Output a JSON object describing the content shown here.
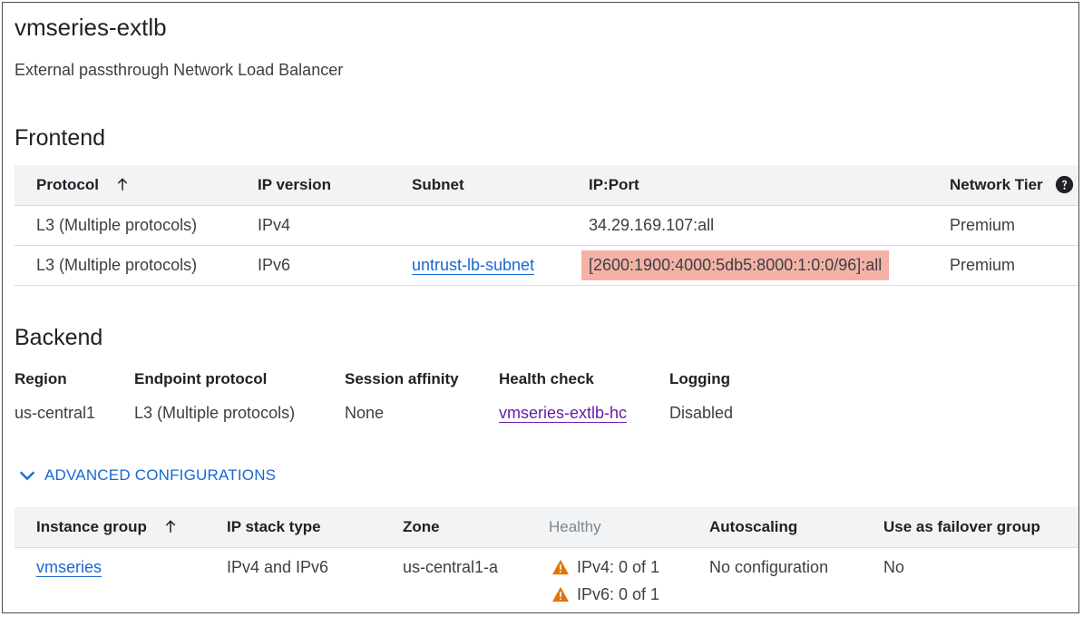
{
  "header": {
    "title": "vmseries-extlb",
    "subtitle": "External passthrough Network Load Balancer"
  },
  "frontend": {
    "section_title": "Frontend",
    "columns": {
      "protocol": "Protocol",
      "ip_version": "IP version",
      "subnet": "Subnet",
      "ip_port": "IP:Port",
      "network_tier": "Network Tier"
    },
    "rows": [
      {
        "protocol": "L3 (Multiple protocols)",
        "ip_version": "IPv4",
        "subnet": "",
        "ip_port": "34.29.169.107:all",
        "network_tier": "Premium"
      },
      {
        "protocol": "L3 (Multiple protocols)",
        "ip_version": "IPv6",
        "subnet": "untrust-lb-subnet",
        "ip_port": "[2600:1900:4000:5db5:8000:1:0:0/96]:all",
        "network_tier": "Premium"
      }
    ]
  },
  "backend": {
    "section_title": "Backend",
    "labels": {
      "region": "Region",
      "endpoint_protocol": "Endpoint protocol",
      "session_affinity": "Session affinity",
      "health_check": "Health check",
      "logging": "Logging"
    },
    "values": {
      "region": "us-central1",
      "endpoint_protocol": "L3 (Multiple protocols)",
      "session_affinity": "None",
      "health_check": "vmseries-extlb-hc",
      "logging": "Disabled"
    },
    "advanced_toggle": "ADVANCED CONFIGURATIONS"
  },
  "instance_groups": {
    "columns": {
      "instance_group": "Instance group",
      "ip_stack_type": "IP stack type",
      "zone": "Zone",
      "healthy": "Healthy",
      "autoscaling": "Autoscaling",
      "failover": "Use as failover group"
    },
    "rows": [
      {
        "instance_group": "vmseries",
        "ip_stack_type": "IPv4 and IPv6",
        "zone": "us-central1-a",
        "healthy_ipv4": "IPv4: 0 of 1",
        "healthy_ipv6": "IPv6: 0 of 1",
        "autoscaling": "No configuration",
        "failover": "No"
      }
    ]
  },
  "icons": {
    "sort": "arrow-up-icon",
    "help": "help-circle-icon",
    "expand": "chevron-down-icon",
    "warning": "warning-triangle-icon"
  },
  "colors": {
    "link": "#1967d2",
    "visited_link": "#681da8",
    "highlight": "#f4b2a6",
    "warning": "#e37400",
    "header_bg": "#f1f3f4"
  }
}
